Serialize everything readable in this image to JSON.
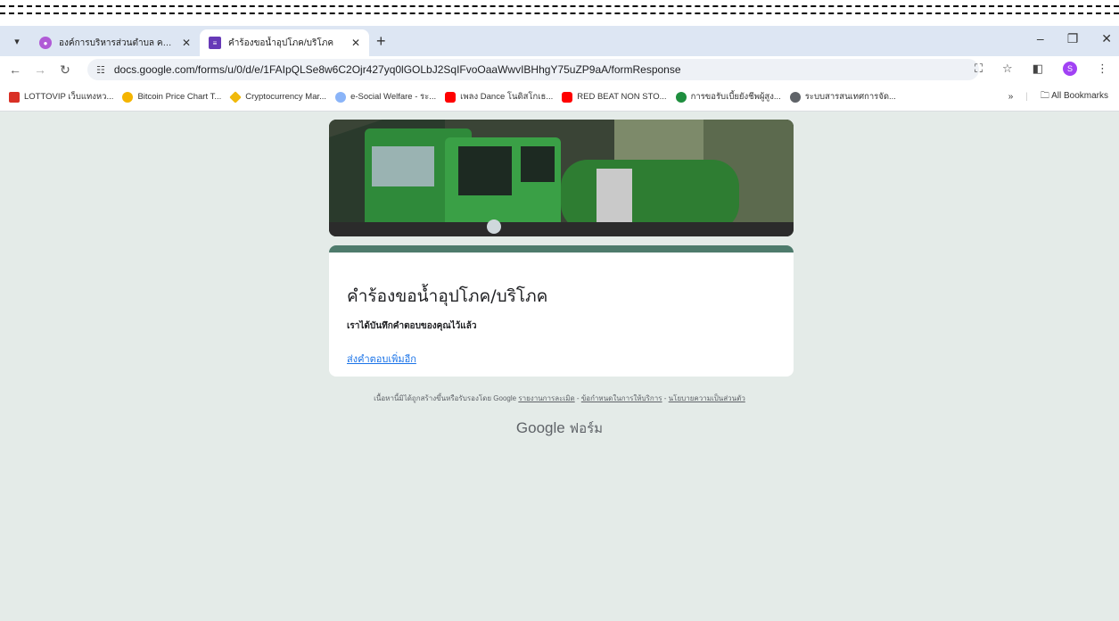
{
  "browser": {
    "tabs": [
      {
        "title": "องค์การบริหารส่วนตำบล คลองทราย",
        "active": false
      },
      {
        "title": "คำร้องขอน้ำอุปโภค/บริโภค",
        "active": true
      }
    ],
    "address": "docs.google.com/forms/u/0/d/e/1FAIpQLSe8w6C2Ojr427yq0lGOLbJ2SqIFvoOaaWwvIBHhgY75uZP9aA/formResponse",
    "profile_initial": "S",
    "bookmarks": [
      "LOTTOVIP เว็บแทงหว...",
      "Bitcoin Price Chart T...",
      "Cryptocurrency Mar...",
      "e-Social Welfare - ระ...",
      "เพลง Dance โนดิสโกเธ...",
      "RED BEAT NON STO...",
      "การขอรับเบี้ยยังชีพผู้สูง...",
      "ระบบสารสนเทศการจัด..."
    ],
    "bookmarks_overflow": "»",
    "all_bookmarks": "All Bookmarks"
  },
  "form": {
    "title": "คำร้องขอน้ำอุปโภค/บริโภค",
    "confirmation": "เราได้บันทึกคำตอบของคุณไว้แล้ว",
    "submit_another": "ส่งคำตอบเพิ่มอีก"
  },
  "footer": {
    "disclaimer": "เนื้อหานี้มิได้ถูกสร้างขึ้นหรือรับรองโดย Google",
    "report_abuse": "รายงานการละเมิด",
    "terms": "ข้อกำหนดในการให้บริการ",
    "privacy": "นโยบายความเป็นส่วนตัว",
    "sep": " - ",
    "brand_google": "Google",
    "brand_forms": "ฟอร์ม"
  },
  "colors": {
    "theme": "#4e7b6c",
    "background": "#e4ebe8",
    "link": "#1a73e8"
  }
}
